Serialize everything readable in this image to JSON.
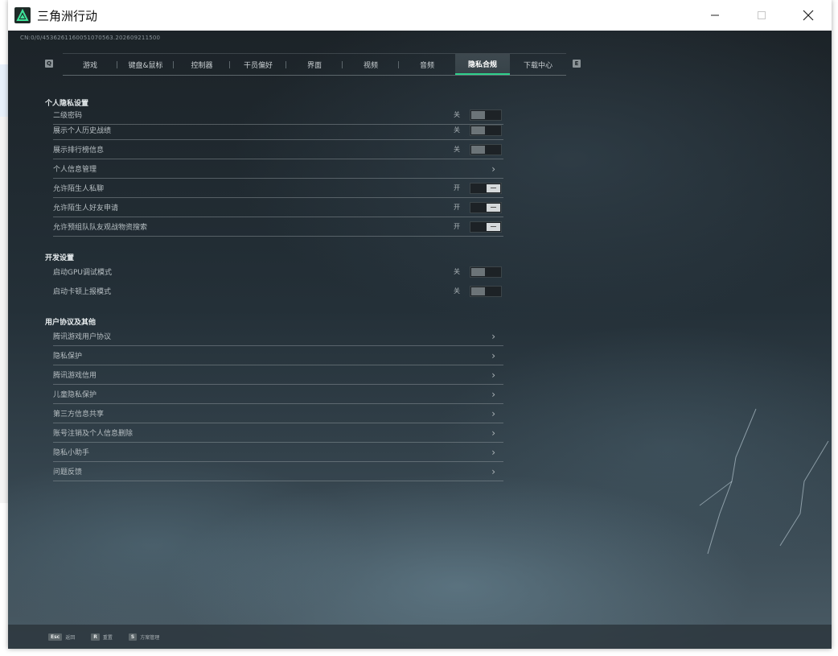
{
  "window": {
    "title": "三角洲行动"
  },
  "build_id": "CN:0/0/4536261160051070563.202609211500",
  "tabs": [
    {
      "label": "游戏"
    },
    {
      "label": "键盘&鼠标"
    },
    {
      "label": "控制器"
    },
    {
      "label": "干员偏好"
    },
    {
      "label": "界面"
    },
    {
      "label": "视频"
    },
    {
      "label": "音频"
    },
    {
      "label": "隐私合规",
      "active": true
    },
    {
      "label": "下载中心"
    }
  ],
  "tab_hints": {
    "prev": "Q",
    "next": "E"
  },
  "sections": {
    "personal": {
      "title": "个人隐私设置",
      "rows": [
        {
          "label": "二级密码",
          "state": "关"
        },
        {
          "label": "展示个人历史战绩",
          "state": "关"
        },
        {
          "label": "展示排行榜信息",
          "state": "关"
        },
        {
          "label": "个人信息管理"
        },
        {
          "label": "允许陌生人私聊",
          "state": "开"
        },
        {
          "label": "允许陌生人好友申请",
          "state": "开"
        },
        {
          "label": "允许预组队队友观战物资搜索",
          "state": "开"
        }
      ]
    },
    "dev": {
      "title": "开发设置",
      "rows": [
        {
          "label": "启动GPU调试模式",
          "state": "关"
        },
        {
          "label": "启动卡顿上报模式",
          "state": "关"
        }
      ]
    },
    "other": {
      "title": "用户协议及其他",
      "rows": [
        {
          "label": "腾讯游戏用户协议"
        },
        {
          "label": "隐私保护"
        },
        {
          "label": "腾讯游戏信用"
        },
        {
          "label": "儿童隐私保护"
        },
        {
          "label": "第三方信息共享"
        },
        {
          "label": "账号注销及个人信息删除"
        },
        {
          "label": "隐私小助手"
        },
        {
          "label": "问题反馈"
        }
      ]
    }
  },
  "bottom_hints": [
    {
      "key": "Esc",
      "label": "返回"
    },
    {
      "key": "R",
      "label": "重置"
    },
    {
      "key": "S",
      "label": "方案管理"
    }
  ],
  "colors": {
    "accent": "#2fd08c"
  }
}
